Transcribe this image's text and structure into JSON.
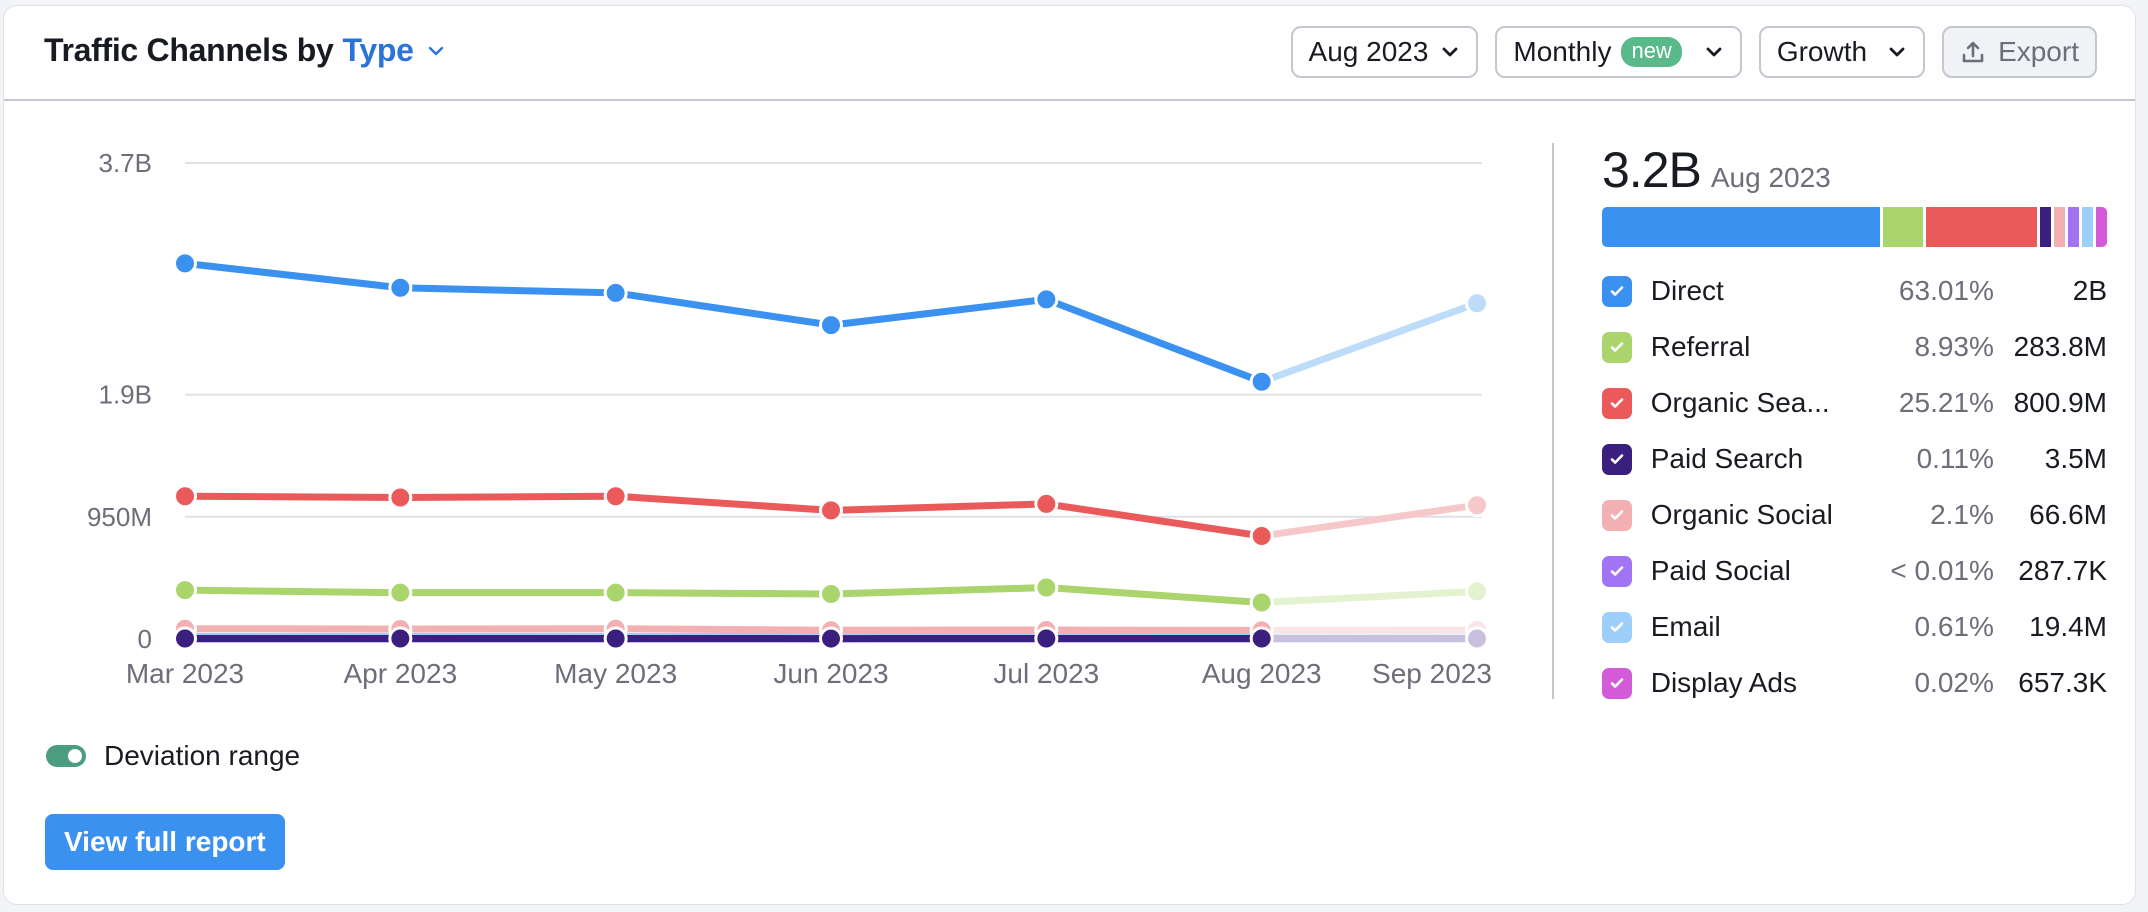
{
  "header": {
    "title_prefix": "Traffic Channels by",
    "title_type": "Type",
    "controls": {
      "date": "Aug 2023",
      "period": "Monthly",
      "period_badge": "new",
      "metric": "Growth",
      "export": "Export"
    }
  },
  "summary": {
    "total": "3.2B",
    "date": "Aug 2023"
  },
  "legend": [
    {
      "name": "Direct",
      "pct": "63.01%",
      "value": "2B",
      "share": 63.01,
      "color": "#3b91f0"
    },
    {
      "name": "Referral",
      "pct": "8.93%",
      "value": "283.8M",
      "share": 8.93,
      "color": "#a9d56c"
    },
    {
      "name": "Organic Sea...",
      "pct": "25.21%",
      "value": "800.9M",
      "share": 25.21,
      "color": "#ea5a5a"
    },
    {
      "name": "Paid Search",
      "pct": "0.11%",
      "value": "3.5M",
      "share": 0.11,
      "color": "#3b1f7f"
    },
    {
      "name": "Organic Social",
      "pct": "2.1%",
      "value": "66.6M",
      "share": 2.1,
      "color": "#f3b0b2"
    },
    {
      "name": "Paid Social",
      "pct": "< 0.01%",
      "value": "287.7K",
      "share": 0.01,
      "color": "#a274f3"
    },
    {
      "name": "Email",
      "pct": "0.61%",
      "value": "19.4M",
      "share": 0.61,
      "color": "#9ecffa"
    },
    {
      "name": "Display Ads",
      "pct": "0.02%",
      "value": "657.3K",
      "share": 0.02,
      "color": "#d35bd8"
    }
  ],
  "footer": {
    "toggle_label": "Deviation range",
    "toggle_on": true,
    "report_button": "View full report"
  },
  "chart_data": {
    "type": "line",
    "title": "Traffic Channels by Type",
    "xlabel": "",
    "ylabel": "",
    "x": [
      "Mar 2023",
      "Apr 2023",
      "May 2023",
      "Jun 2023",
      "Jul 2023",
      "Aug 2023",
      "Sep 2023"
    ],
    "yticks": [
      {
        "value": 0,
        "label": "0"
      },
      {
        "value": 950000000,
        "label": "950M"
      },
      {
        "value": 1900000000,
        "label": "1.9B"
      },
      {
        "value": 3700000000,
        "label": "3.7B"
      }
    ],
    "ylim": [
      0,
      3700000000
    ],
    "grid": true,
    "projected_from_index": 5,
    "series": [
      {
        "name": "Display Ads",
        "color": "#d35bd8",
        "faded": "#efcbf1",
        "values": [
          650000,
          660000,
          650000,
          640000,
          655000,
          657300,
          660000
        ]
      },
      {
        "name": "Email",
        "color": "#9ecffa",
        "faded": "#e0effd",
        "values": [
          20000000,
          20000000,
          20000000,
          19000000,
          19500000,
          19400000,
          19500000
        ]
      },
      {
        "name": "Paid Social",
        "color": "#a274f3",
        "faded": "#e3d5fb",
        "values": [
          300000,
          300000,
          290000,
          285000,
          290000,
          287700,
          290000
        ]
      },
      {
        "name": "Organic Social",
        "color": "#f3b0b2",
        "faded": "#fbe4e5",
        "values": [
          80000000,
          78000000,
          80000000,
          68000000,
          70000000,
          66600000,
          70000000
        ]
      },
      {
        "name": "Paid Search",
        "color": "#3b1f7f",
        "faded": "#c9c0dd",
        "values": [
          3600000,
          3600000,
          3500000,
          3400000,
          3500000,
          3500000,
          3500000
        ]
      },
      {
        "name": "Referral",
        "color": "#a9d56c",
        "faded": "#e3f2cf",
        "values": [
          380000000,
          360000000,
          360000000,
          350000000,
          400000000,
          283800000,
          370000000
        ]
      },
      {
        "name": "Organic Search",
        "color": "#ea5a5a",
        "faded": "#f6c8c9",
        "values": [
          1110000000,
          1100000000,
          1110000000,
          1000000000,
          1050000000,
          800900000,
          1040000000
        ]
      },
      {
        "name": "Direct",
        "color": "#3b91f0",
        "faded": "#bcdcf9",
        "values": [
          2920000000,
          2730000000,
          2690000000,
          2440000000,
          2640000000,
          2000000000,
          2610000000
        ]
      }
    ]
  }
}
